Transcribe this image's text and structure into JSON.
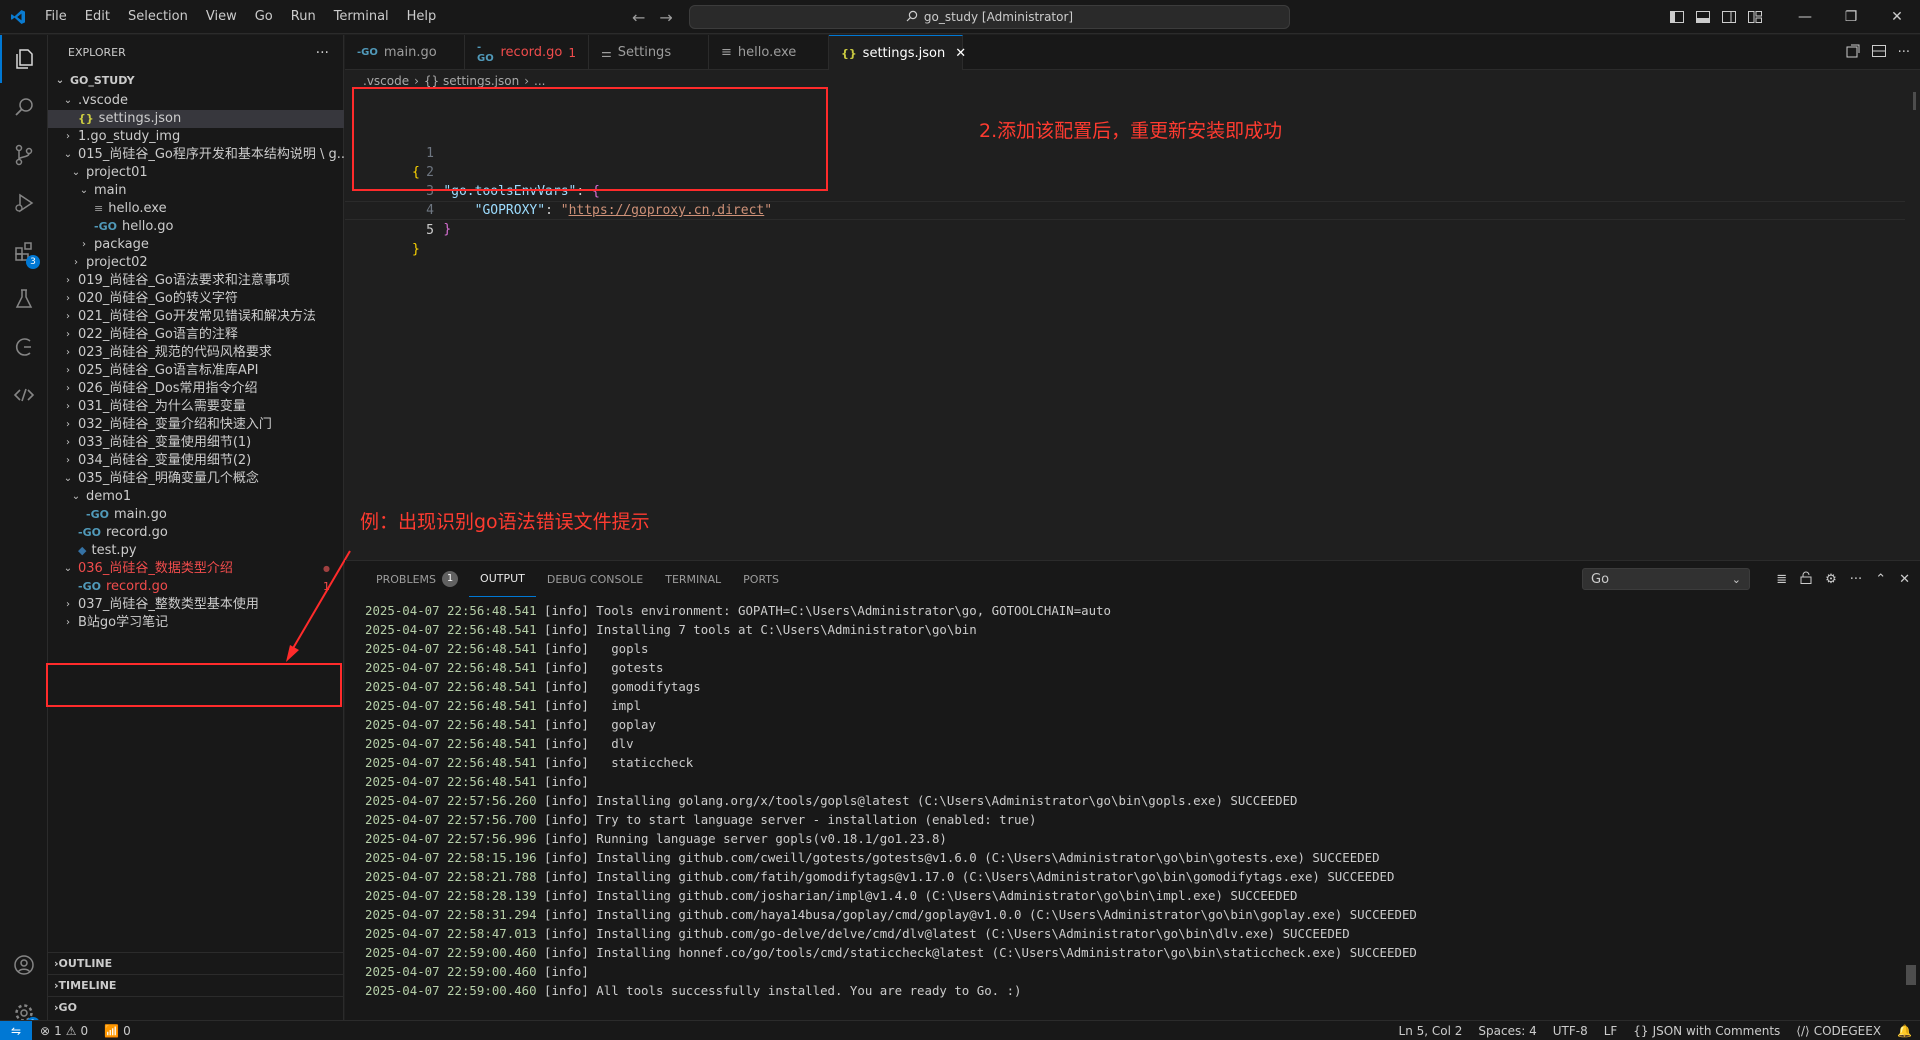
{
  "titlebar": {
    "menu": [
      "File",
      "Edit",
      "Selection",
      "View",
      "Go",
      "Run",
      "Terminal",
      "Help"
    ],
    "search_text": "go_study [Administrator]",
    "window_buttons": [
      "—",
      "❐",
      "✕"
    ]
  },
  "activitybar": {
    "extensions_badge": "3",
    "settings_badge": "1"
  },
  "sidebar": {
    "title": "EXPLORER",
    "more": "···",
    "root": "GO_STUDY",
    "items": [
      {
        "label": ".vscode",
        "type": "folder",
        "open": true
      },
      {
        "label": "settings.json",
        "type": "json"
      },
      {
        "label": "1.go_study_img",
        "type": "folder",
        "open": false
      },
      {
        "label": "015_尚硅谷_Go程序开发和基本结构说明 \\ g...",
        "type": "folder",
        "open": true
      },
      {
        "label": "project01",
        "type": "folder",
        "open": true
      },
      {
        "label": "main",
        "type": "folder",
        "open": true
      },
      {
        "label": "hello.exe",
        "type": "exe"
      },
      {
        "label": "hello.go",
        "type": "go"
      },
      {
        "label": "package",
        "type": "folder",
        "open": false
      },
      {
        "label": "project02",
        "type": "folder",
        "open": false
      },
      {
        "label": "019_尚硅谷_Go语法要求和注意事项",
        "type": "folder",
        "open": false
      },
      {
        "label": "020_尚硅谷_Go的转义字符",
        "type": "folder",
        "open": false
      },
      {
        "label": "021_尚硅谷_Go开发常见错误和解决方法",
        "type": "folder",
        "open": false
      },
      {
        "label": "022_尚硅谷_Go语言的注释",
        "type": "folder",
        "open": false
      },
      {
        "label": "023_尚硅谷_规范的代码风格要求",
        "type": "folder",
        "open": false
      },
      {
        "label": "025_尚硅谷_Go语言标准库API",
        "type": "folder",
        "open": false
      },
      {
        "label": "026_尚硅谷_Dos常用指令介绍",
        "type": "folder",
        "open": false
      },
      {
        "label": "031_尚硅谷_为什么需要变量",
        "type": "folder",
        "open": false
      },
      {
        "label": "032_尚硅谷_变量介绍和快速入门",
        "type": "folder",
        "open": false
      },
      {
        "label": "033_尚硅谷_变量使用细节(1)",
        "type": "folder",
        "open": false
      },
      {
        "label": "034_尚硅谷_变量使用细节(2)",
        "type": "folder",
        "open": false
      },
      {
        "label": "035_尚硅谷_明确变量几个概念",
        "type": "folder",
        "open": true
      },
      {
        "label": "demo1",
        "type": "folder",
        "open": true
      },
      {
        "label": "main.go",
        "type": "go"
      },
      {
        "label": "record.go",
        "type": "go"
      },
      {
        "label": "test.py",
        "type": "py"
      },
      {
        "label": "036_尚硅谷_数据类型介绍",
        "type": "folder",
        "open": true,
        "error": true
      },
      {
        "label": "record.go",
        "type": "go",
        "error": true,
        "problems": "1"
      },
      {
        "label": "037_尚硅谷_整数类型基本使用",
        "type": "folder",
        "open": false
      },
      {
        "label": "B站go学习笔记",
        "type": "folder",
        "open": false
      }
    ],
    "sections": [
      "OUTLINE",
      "TIMELINE",
      "GO"
    ]
  },
  "editor": {
    "tabs": [
      {
        "label": "main.go",
        "icon": "go"
      },
      {
        "label": "record.go",
        "icon": "go",
        "problems": "1",
        "error": true
      },
      {
        "label": "Settings",
        "icon": "settings"
      },
      {
        "label": "hello.exe",
        "icon": "exe"
      },
      {
        "label": "settings.json",
        "icon": "json",
        "active": true
      }
    ],
    "breadcrumb": [
      ".vscode",
      "{} settings.json",
      "..."
    ],
    "line_numbers": [
      "1",
      "2",
      "3",
      "4",
      "5"
    ],
    "code": {
      "key1": "\"go.toolsEnvVars\"",
      "key2": "\"GOPROXY\"",
      "value": "https://goproxy.cn,direct"
    }
  },
  "annotations": {
    "note1": "2.添加该配置后，重更新安装即成功",
    "note2": "例：出现识别go语法错误文件提示"
  },
  "panel": {
    "tabs": [
      {
        "label": "PROBLEMS",
        "count": "1"
      },
      {
        "label": "OUTPUT",
        "active": true
      },
      {
        "label": "DEBUG CONSOLE"
      },
      {
        "label": "TERMINAL"
      },
      {
        "label": "PORTS"
      }
    ],
    "output_channel": "Go",
    "lines": [
      {
        "ts": "2025-04-07 22:56:48.541",
        "tag": "[info]",
        "msg": "Tools environment: GOPATH=C:\\Users\\Administrator\\go, GOTOOLCHAIN=auto"
      },
      {
        "ts": "2025-04-07 22:56:48.541",
        "tag": "[info]",
        "msg": "Installing 7 tools at C:\\Users\\Administrator\\go\\bin"
      },
      {
        "ts": "2025-04-07 22:56:48.541",
        "tag": "[info]",
        "msg": "  gopls"
      },
      {
        "ts": "2025-04-07 22:56:48.541",
        "tag": "[info]",
        "msg": "  gotests"
      },
      {
        "ts": "2025-04-07 22:56:48.541",
        "tag": "[info]",
        "msg": "  gomodifytags"
      },
      {
        "ts": "2025-04-07 22:56:48.541",
        "tag": "[info]",
        "msg": "  impl"
      },
      {
        "ts": "2025-04-07 22:56:48.541",
        "tag": "[info]",
        "msg": "  goplay"
      },
      {
        "ts": "2025-04-07 22:56:48.541",
        "tag": "[info]",
        "msg": "  dlv"
      },
      {
        "ts": "2025-04-07 22:56:48.541",
        "tag": "[info]",
        "msg": "  staticcheck"
      },
      {
        "ts": "2025-04-07 22:56:48.541",
        "tag": "[info]",
        "msg": ""
      },
      {
        "ts": "2025-04-07 22:57:56.260",
        "tag": "[info]",
        "msg": "Installing golang.org/x/tools/gopls@latest (C:\\Users\\Administrator\\go\\bin\\gopls.exe) SUCCEEDED"
      },
      {
        "ts": "2025-04-07 22:57:56.700",
        "tag": "[info]",
        "msg": "Try to start language server - installation (enabled: true)"
      },
      {
        "ts": "2025-04-07 22:57:56.996",
        "tag": "[info]",
        "msg": "Running language server gopls(v0.18.1/go1.23.8)"
      },
      {
        "ts": "2025-04-07 22:58:15.196",
        "tag": "[info]",
        "msg": "Installing github.com/cweill/gotests/gotests@v1.6.0 (C:\\Users\\Administrator\\go\\bin\\gotests.exe) SUCCEEDED"
      },
      {
        "ts": "2025-04-07 22:58:21.788",
        "tag": "[info]",
        "msg": "Installing github.com/fatih/gomodifytags@v1.17.0 (C:\\Users\\Administrator\\go\\bin\\gomodifytags.exe) SUCCEEDED"
      },
      {
        "ts": "2025-04-07 22:58:28.139",
        "tag": "[info]",
        "msg": "Installing github.com/josharian/impl@v1.4.0 (C:\\Users\\Administrator\\go\\bin\\impl.exe) SUCCEEDED"
      },
      {
        "ts": "2025-04-07 22:58:31.294",
        "tag": "[info]",
        "msg": "Installing github.com/haya14busa/goplay/cmd/goplay@v1.0.0 (C:\\Users\\Administrator\\go\\bin\\goplay.exe) SUCCEEDED"
      },
      {
        "ts": "2025-04-07 22:58:47.013",
        "tag": "[info]",
        "msg": "Installing github.com/go-delve/delve/cmd/dlv@latest (C:\\Users\\Administrator\\go\\bin\\dlv.exe) SUCCEEDED"
      },
      {
        "ts": "2025-04-07 22:59:00.460",
        "tag": "[info]",
        "msg": "Installing honnef.co/go/tools/cmd/staticcheck@latest (C:\\Users\\Administrator\\go\\bin\\staticcheck.exe) SUCCEEDED"
      },
      {
        "ts": "2025-04-07 22:59:00.460",
        "tag": "[info]",
        "msg": ""
      },
      {
        "ts": "2025-04-07 22:59:00.460",
        "tag": "[info]",
        "msg": "All tools successfully installed. You are ready to Go. :)"
      }
    ]
  },
  "statusbar": {
    "errors": "1",
    "warnings": "0",
    "ports": "0",
    "position": "Ln 5, Col 2",
    "spaces": "Spaces: 4",
    "encoding": "UTF-8",
    "eol": "LF",
    "language": "JSON with Comments",
    "codegeex": "CODEGEEX"
  },
  "colors": {
    "accent": "#0078d4",
    "annotation_red": "#ff2b2b",
    "error_red": "#f14c4c"
  }
}
